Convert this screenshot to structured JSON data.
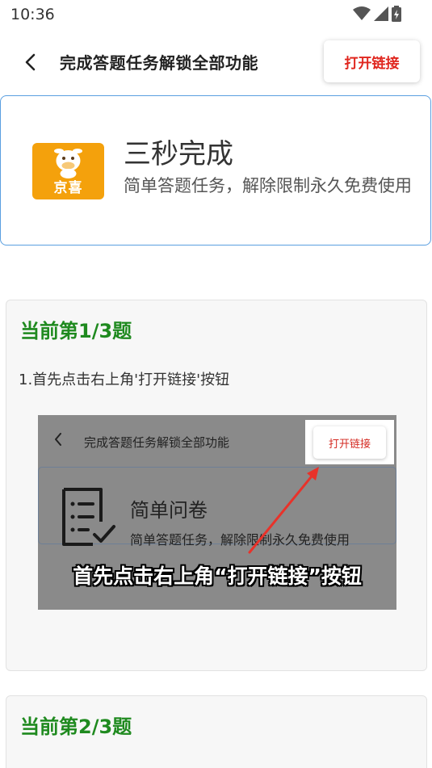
{
  "status_bar": {
    "time": "10:36",
    "icons": [
      "wifi-icon",
      "signal-icon",
      "battery-icon"
    ]
  },
  "header": {
    "title": "完成答题任务解锁全部功能",
    "open_link_label": "打开链接",
    "back_icon": "back-arrow-icon"
  },
  "app_card": {
    "logo_text": "京喜",
    "name": "三秒完成",
    "description": "简单答题任务，解除限制永久免费使用"
  },
  "questions": [
    {
      "title": "当前第1/3题",
      "step": "1.首先点击右上角'打开链接'按钮",
      "tutorial": {
        "title": "完成答题任务解锁全部功能",
        "button": "打开链接",
        "card_name": "简单问卷",
        "card_desc": "简单答题任务，解除限制永久免费使用",
        "caption": "首先点击右上角“打开链接”按钮"
      }
    },
    {
      "title": "当前第2/3题"
    }
  ],
  "colors": {
    "accent_red": "#e0261e",
    "question_green": "#1f8a1f",
    "card_border_blue": "#5a9fe0",
    "logo_orange": "#f4a10c"
  }
}
